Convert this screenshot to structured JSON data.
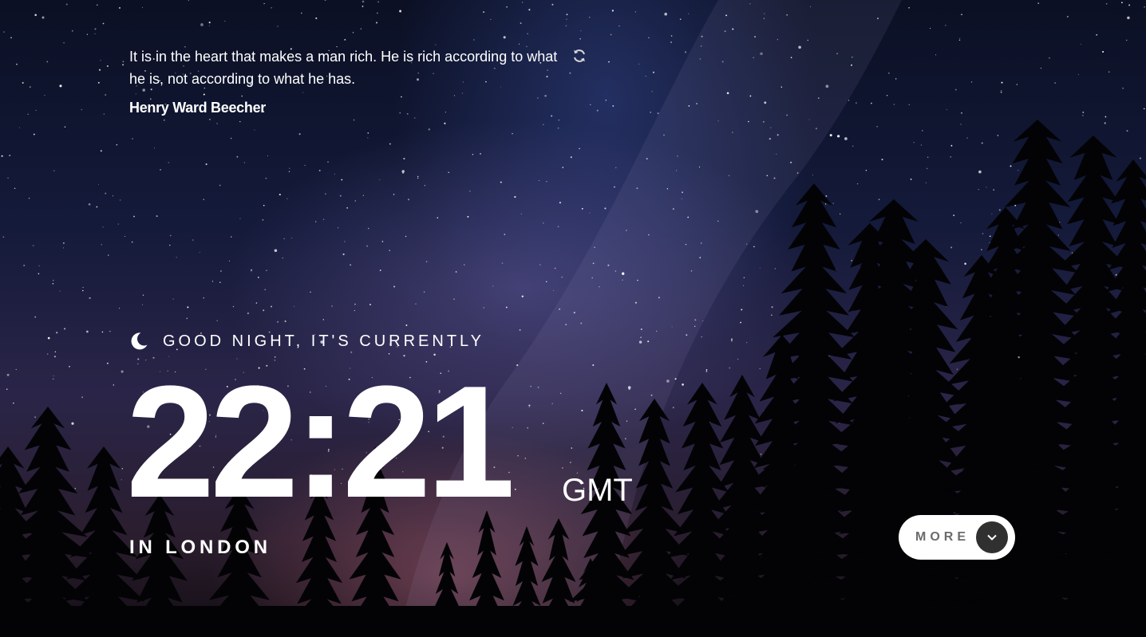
{
  "quote": {
    "text": "It is in the heart that makes a man rich. He is rich according to what he is, not according to what he has.",
    "author": "Henry Ward Beecher",
    "refresh_icon": "refresh-icon"
  },
  "greeting": {
    "icon": "moon-icon",
    "text": "GOOD NIGHT, IT'S CURRENTLY"
  },
  "clock": {
    "time": "22:21",
    "timezone": "GMT",
    "location": "IN LONDON"
  },
  "more_button": {
    "label": "MORE",
    "icon": "chevron-down-icon"
  },
  "colors": {
    "text": "#ffffff",
    "button_bg": "#ffffff",
    "button_label": "#6b6b6b",
    "chevron_bg": "#303030"
  }
}
